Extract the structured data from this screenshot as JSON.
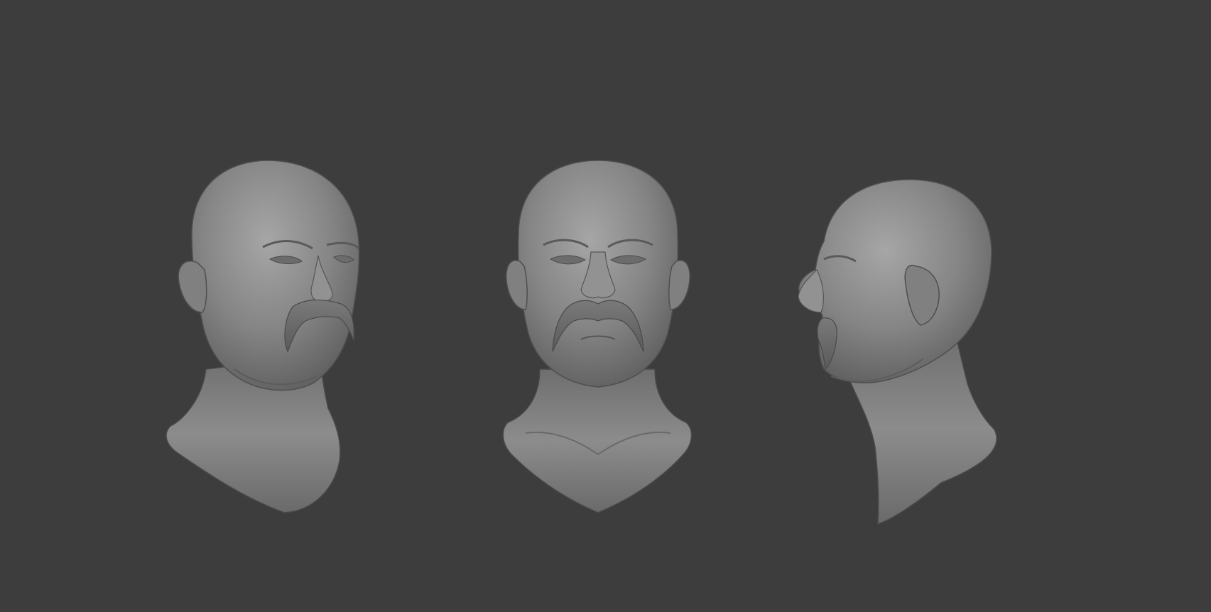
{
  "canvas": {
    "background": "#3d3d3d",
    "clay_color": "#8a8a8a"
  },
  "views": [
    {
      "name": "three-quarter-view"
    },
    {
      "name": "front-view"
    },
    {
      "name": "side-profile-view"
    }
  ]
}
